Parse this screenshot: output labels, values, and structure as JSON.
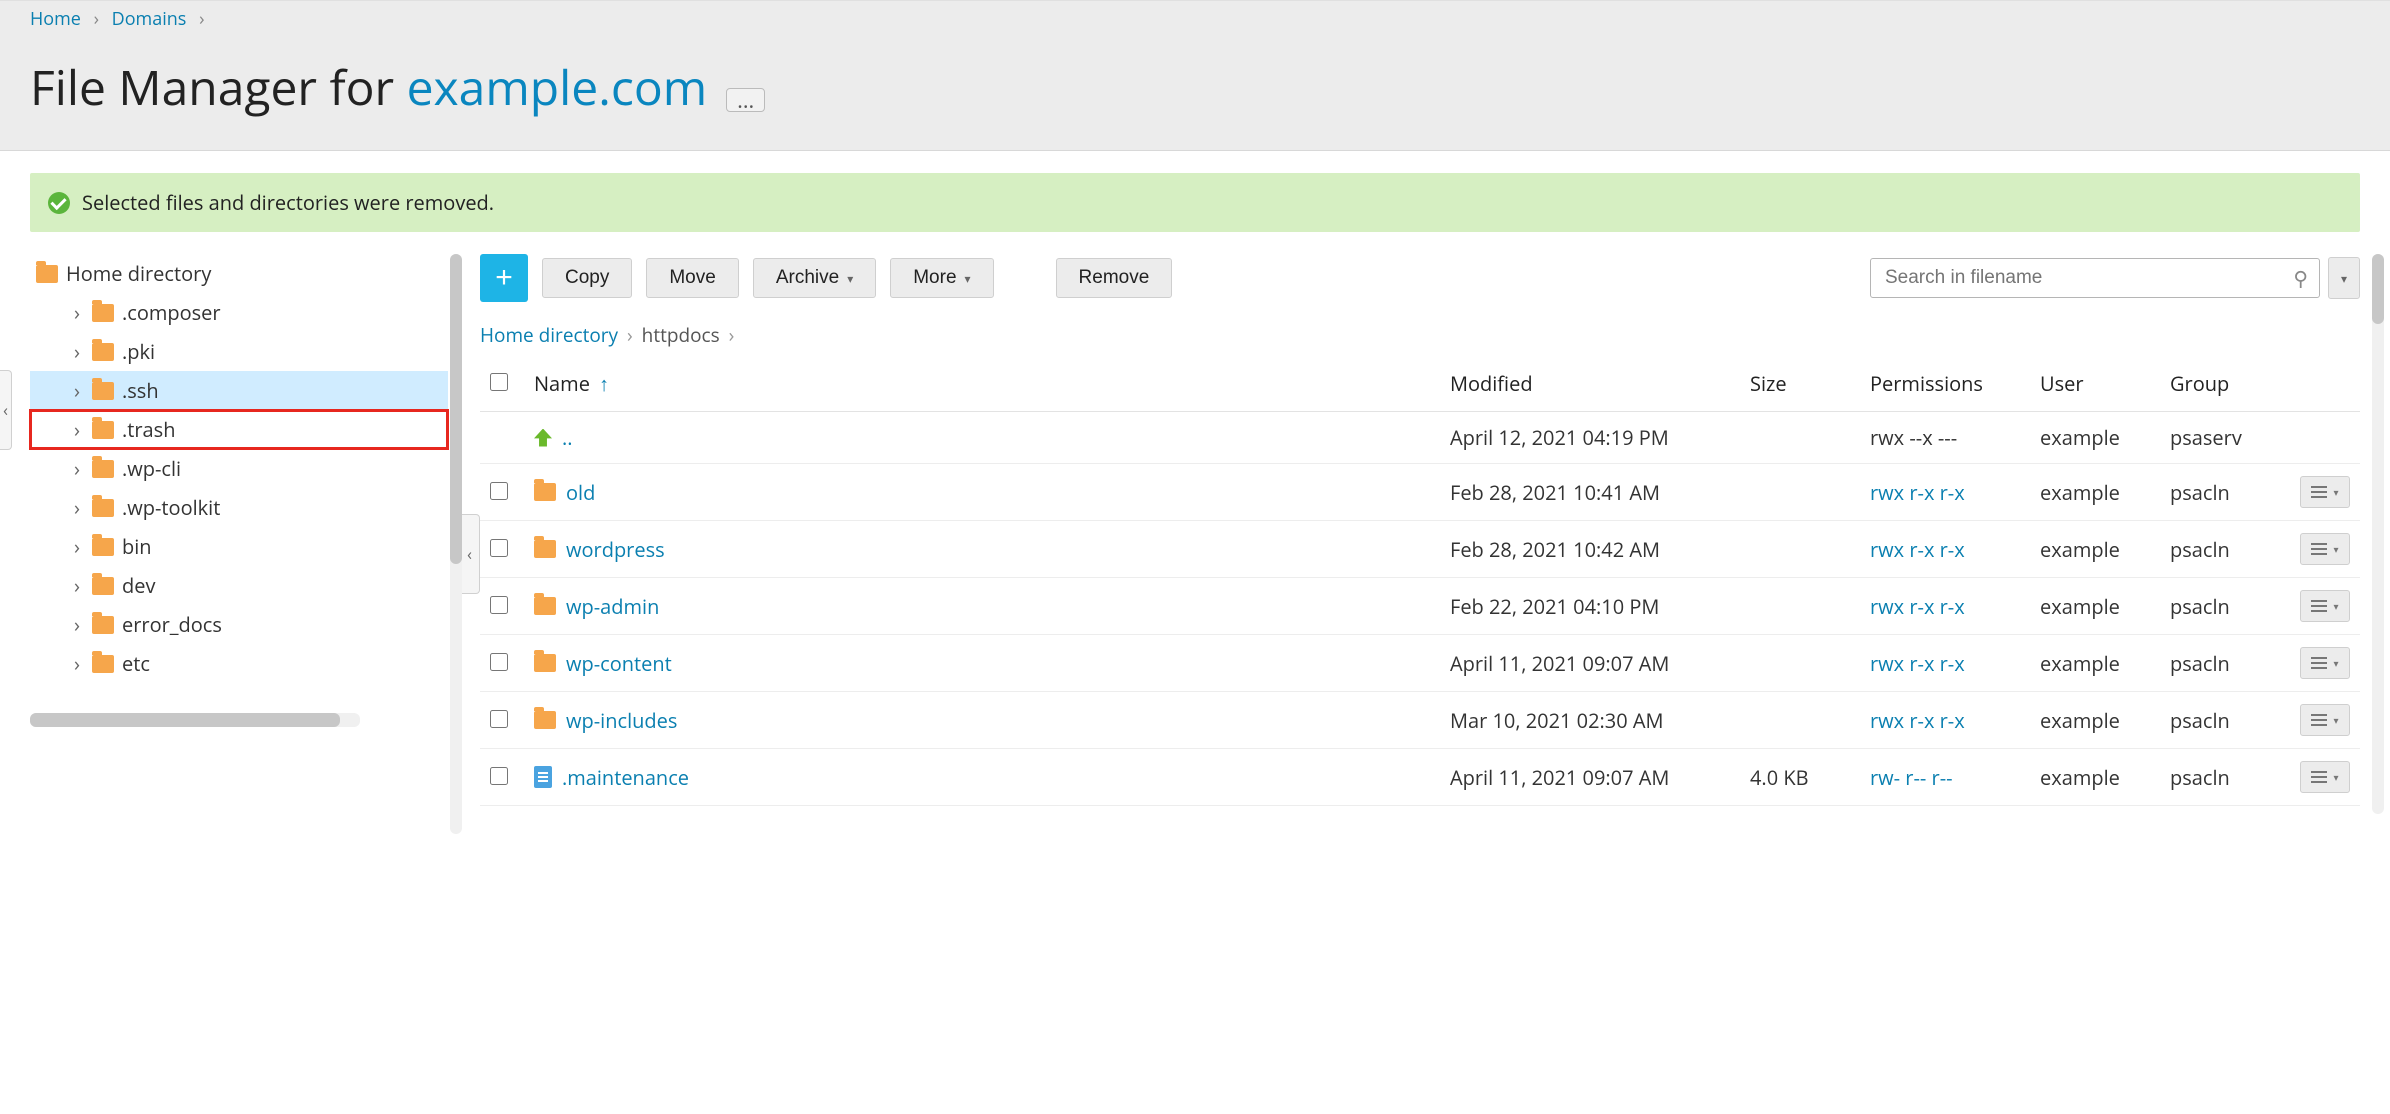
{
  "breadcrumb": {
    "home": "Home",
    "domains": "Domains"
  },
  "title": {
    "prefix": "File Manager for ",
    "domain": "example.com"
  },
  "alert": {
    "message": "Selected files and directories were removed."
  },
  "tree": {
    "root": "Home directory",
    "items": [
      {
        "label": ".composer"
      },
      {
        "label": ".pki"
      },
      {
        "label": ".ssh",
        "selected": true
      },
      {
        "label": ".trash",
        "highlighted": true
      },
      {
        "label": ".wp-cli"
      },
      {
        "label": ".wp-toolkit"
      },
      {
        "label": "bin"
      },
      {
        "label": "dev"
      },
      {
        "label": "error_docs"
      },
      {
        "label": "etc"
      }
    ]
  },
  "toolbar": {
    "copy": "Copy",
    "move": "Move",
    "archive": "Archive",
    "more": "More",
    "remove": "Remove"
  },
  "search": {
    "placeholder": "Search in filename"
  },
  "path": {
    "root": "Home directory",
    "current": "httpdocs"
  },
  "columns": {
    "name": "Name",
    "modified": "Modified",
    "size": "Size",
    "permissions": "Permissions",
    "user": "User",
    "group": "Group"
  },
  "parent_row": {
    "name": "..",
    "modified": "April 12, 2021 04:19 PM",
    "permissions": "rwx --x ---",
    "user": "example",
    "group": "psaserv"
  },
  "rows": [
    {
      "type": "folder",
      "name": "old",
      "modified": "Feb 28, 2021 10:41 AM",
      "size": "",
      "permissions": "rwx r-x r-x",
      "user": "example",
      "group": "psacln"
    },
    {
      "type": "folder",
      "name": "wordpress",
      "modified": "Feb 28, 2021 10:42 AM",
      "size": "",
      "permissions": "rwx r-x r-x",
      "user": "example",
      "group": "psacln"
    },
    {
      "type": "folder",
      "name": "wp-admin",
      "modified": "Feb 22, 2021 04:10 PM",
      "size": "",
      "permissions": "rwx r-x r-x",
      "user": "example",
      "group": "psacln"
    },
    {
      "type": "folder",
      "name": "wp-content",
      "modified": "April 11, 2021 09:07 AM",
      "size": "",
      "permissions": "rwx r-x r-x",
      "user": "example",
      "group": "psacln"
    },
    {
      "type": "folder",
      "name": "wp-includes",
      "modified": "Mar 10, 2021 02:30 AM",
      "size": "",
      "permissions": "rwx r-x r-x",
      "user": "example",
      "group": "psacln"
    },
    {
      "type": "file",
      "name": ".maintenance",
      "modified": "April 11, 2021 09:07 AM",
      "size": "4.0 KB",
      "permissions": "rw- r-- r--",
      "user": "example",
      "group": "psacln"
    }
  ]
}
